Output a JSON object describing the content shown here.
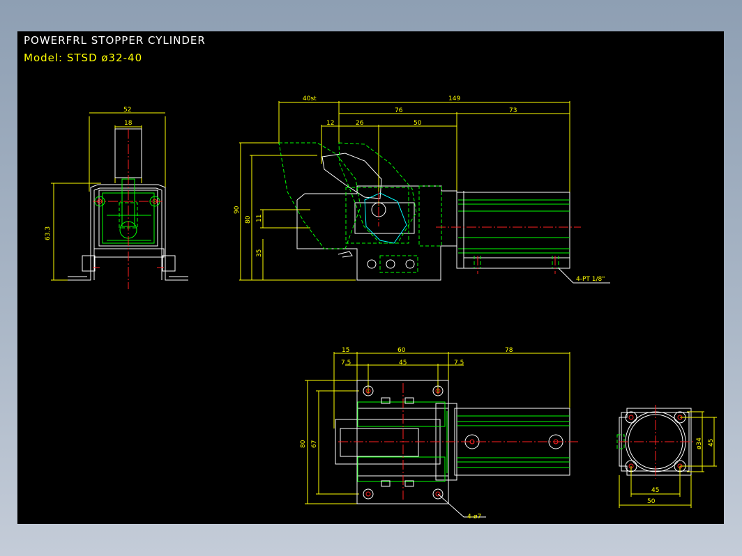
{
  "header": {
    "title": "POWERFRL  STOPPER  CYLINDER",
    "model": "Model: STSD  ø32-40"
  },
  "views": {
    "side": {
      "w52": "52",
      "w18": "18",
      "h63": "63.3"
    },
    "front": {
      "d40st": "40st",
      "d149": "149",
      "d76": "76",
      "d73": "73",
      "d12": "12",
      "d26": "26",
      "d50": "50",
      "v90": "90",
      "v80": "80",
      "v11": "11",
      "v35": "35",
      "port": "4-PT 1/8\""
    },
    "top": {
      "d15": "15",
      "d60": "60",
      "d78": "78",
      "d75a": "7.5",
      "d45": "45",
      "d75b": "7.5",
      "v80": "80",
      "v67": "67",
      "holes": "4-ø7"
    },
    "end": {
      "v34": "ø34",
      "v45": "45",
      "h45": "45",
      "h50": "50"
    }
  },
  "colors": {
    "sheet": "#000000",
    "dimension": "#ffff00",
    "outline": "#00ff00",
    "center": "#ff2020",
    "edge": "#ffffff"
  }
}
